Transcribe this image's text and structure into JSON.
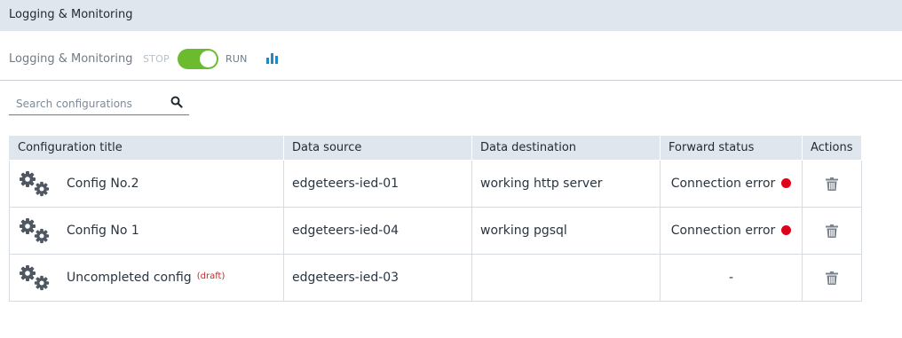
{
  "header": {
    "title": "Logging & Monitoring"
  },
  "toolbar": {
    "label": "Logging & Monitoring",
    "stop_label": "STOP",
    "run_label": "RUN",
    "toggle_state": "on",
    "stats_icon": "bar-chart-icon",
    "accent_color": "#6cbb2e"
  },
  "search": {
    "placeholder": "Search configurations",
    "value": "",
    "icon": "search-icon"
  },
  "table": {
    "headers": [
      "Configuration title",
      "Data source",
      "Data destination",
      "Forward status",
      "Actions"
    ],
    "rows": [
      {
        "title": "Config No.2",
        "draft": "",
        "source": "edgeteers-ied-01",
        "destination": "working http server",
        "status": "Connection error",
        "status_color": "#e0001b"
      },
      {
        "title": "Config No 1",
        "draft": "",
        "source": "edgeteers-ied-04",
        "destination": "working pgsql",
        "status": "Connection error",
        "status_color": "#e0001b"
      },
      {
        "title": "Uncompleted config",
        "draft": "(draft)",
        "source": "edgeteers-ied-03",
        "destination": "",
        "status": "-",
        "status_color": ""
      }
    ],
    "row_icon": "gears-icon",
    "action_icon": "trash-icon"
  }
}
